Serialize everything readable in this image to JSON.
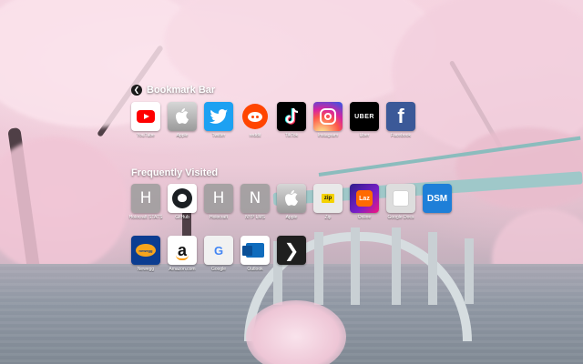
{
  "bookmark_bar": {
    "title": "Bookmark Bar",
    "back_icon": "back-arrow-icon",
    "items": [
      {
        "label": "YouTube",
        "icon": "youtube-icon"
      },
      {
        "label": "Apple",
        "icon": "apple-icon"
      },
      {
        "label": "Twitter",
        "icon": "twitter-icon"
      },
      {
        "label": "reddit",
        "icon": "reddit-icon"
      },
      {
        "label": "TikTok",
        "icon": "tiktok-icon"
      },
      {
        "label": "Instagram",
        "icon": "instagram-icon"
      },
      {
        "label": "Uber",
        "icon": "uber-icon",
        "text": "UBER"
      },
      {
        "label": "Facebook",
        "icon": "facebook-icon",
        "text": "f"
      }
    ]
  },
  "frequently_visited": {
    "title": "Frequently Visited",
    "row1": [
      {
        "label": "Holocraft STATS",
        "icon": "letter-h-icon",
        "text": "H"
      },
      {
        "label": "GitHub",
        "icon": "github-icon"
      },
      {
        "label": "Holocraft",
        "icon": "letter-h-icon",
        "text": "H"
      },
      {
        "label": "NYP LMS",
        "icon": "letter-n-icon",
        "text": "N"
      },
      {
        "label": "Apple",
        "icon": "apple-icon"
      },
      {
        "label": "Zip",
        "icon": "zip-icon",
        "text": "zip"
      },
      {
        "label": "Online",
        "icon": "lazada-icon",
        "text": "Laz"
      },
      {
        "label": "Google Docs",
        "icon": "document-icon"
      },
      {
        "label": "",
        "icon": "dsm-icon",
        "text": "DSM"
      }
    ],
    "row2": [
      {
        "label": "Newegg",
        "icon": "newegg-icon",
        "text": "newegg"
      },
      {
        "label": "Amazon.com",
        "icon": "amazon-icon",
        "text": "a"
      },
      {
        "label": "Google",
        "icon": "google-icon",
        "text": "G"
      },
      {
        "label": "Outlook",
        "icon": "outlook-icon"
      },
      {
        "label": "",
        "icon": "plex-icon",
        "text": "❯"
      }
    ]
  }
}
